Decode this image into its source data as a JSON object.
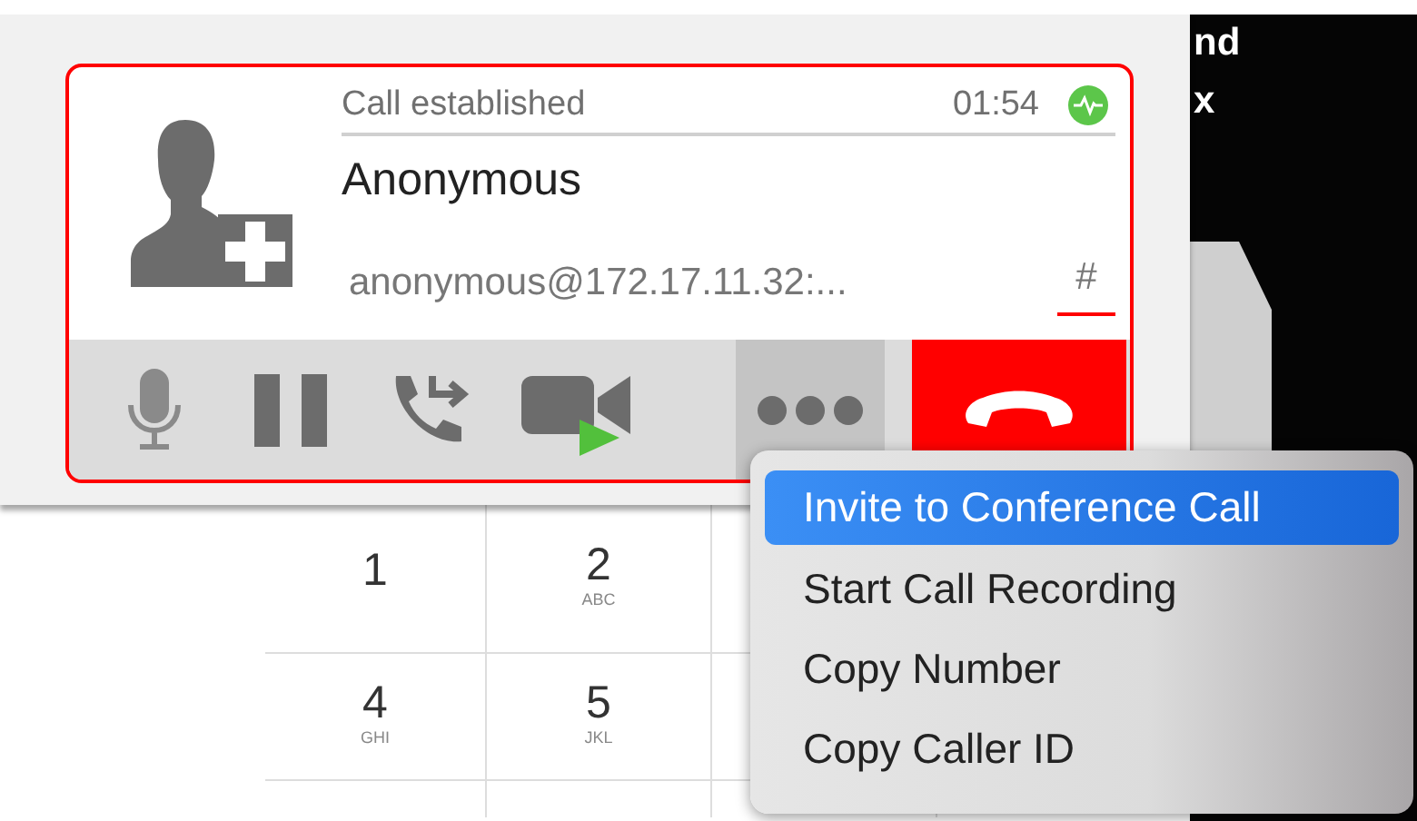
{
  "call": {
    "status": "Call established",
    "timer": "01:54",
    "name": "Anonymous",
    "address": "anonymous@172.17.11.32:...",
    "keypad_toggle": "#"
  },
  "toolbar": [
    {
      "kind": "mic",
      "pressed": false
    },
    {
      "kind": "pause",
      "pressed": false
    },
    {
      "kind": "transfer",
      "pressed": false
    },
    {
      "kind": "video",
      "pressed": false
    },
    {
      "kind": "more",
      "pressed": true
    },
    {
      "kind": "hangup",
      "pressed": false
    }
  ],
  "keypad": [
    {
      "digit": "1"
    },
    {
      "digit": "2",
      "letters": "ABC"
    },
    {
      "digit": "4",
      "letters": "GHI"
    },
    {
      "digit": "5",
      "letters": "JKL"
    }
  ],
  "background_text": [
    "nd",
    "x"
  ],
  "menu": [
    {
      "label": "Invite to Conference Call",
      "selected": true
    },
    {
      "label": "Start Call Recording",
      "selected": false
    },
    {
      "label": "Copy Number",
      "selected": false
    },
    {
      "label": "Copy Caller ID",
      "selected": false
    }
  ]
}
